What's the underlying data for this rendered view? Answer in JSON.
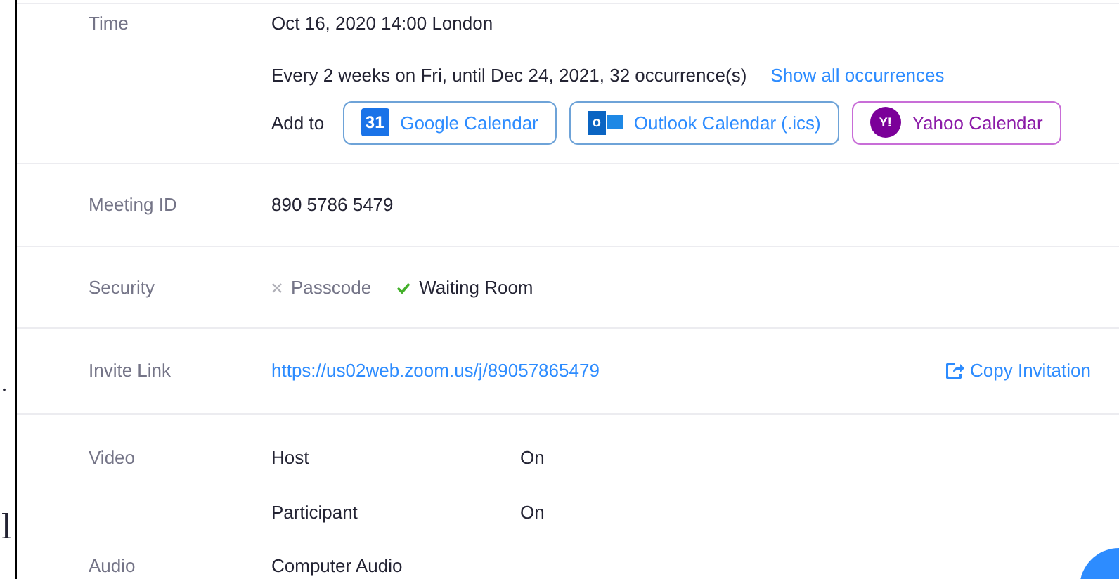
{
  "margin_fragments": [
    ".",
    "l"
  ],
  "time": {
    "label": "Time",
    "start": "Oct 16, 2020 14:00 London",
    "recurrence": "Every 2 weeks on Fri, until Dec 24, 2021, 32 occurrence(s)",
    "show_all_link": "Show all occurrences",
    "add_to_label": "Add to",
    "calendars": [
      {
        "kind": "google",
        "label": "Google Calendar",
        "icon_text": "31"
      },
      {
        "kind": "outlook",
        "label": "Outlook Calendar (.ics)",
        "icon_text": "o"
      },
      {
        "kind": "yahoo",
        "label": "Yahoo Calendar",
        "icon_text": "Y!"
      }
    ]
  },
  "meeting_id": {
    "label": "Meeting ID",
    "value": "890 5786 5479"
  },
  "security": {
    "label": "Security",
    "options": [
      {
        "label": "Passcode",
        "checked": false
      },
      {
        "label": "Waiting Room",
        "checked": true
      }
    ]
  },
  "invite_link": {
    "label": "Invite Link",
    "url": "https://us02web.zoom.us/j/89057865479",
    "copy_button": "Copy Invitation"
  },
  "video": {
    "label": "Video",
    "settings": [
      {
        "name": "Host",
        "value": "On"
      },
      {
        "name": "Participant",
        "value": "On"
      }
    ]
  },
  "audio": {
    "label": "Audio",
    "value": "Computer Audio"
  }
}
